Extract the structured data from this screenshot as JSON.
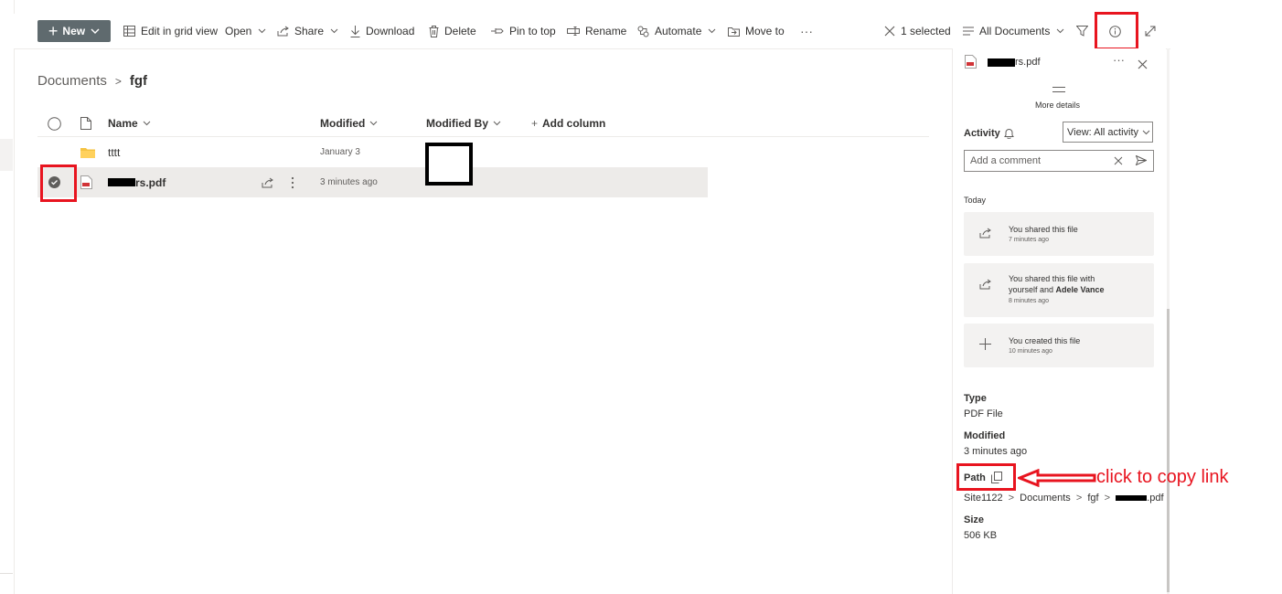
{
  "toolbar": {
    "new_label": "New",
    "edit_grid_label": "Edit in grid view",
    "open_label": "Open",
    "share_label": "Share",
    "download_label": "Download",
    "delete_label": "Delete",
    "pin_label": "Pin to top",
    "rename_label": "Rename",
    "automate_label": "Automate",
    "move_label": "Move to",
    "more_label": "···",
    "selected_label": "1 selected",
    "view_label": "All Documents"
  },
  "breadcrumb": {
    "root": "Documents",
    "current": "fgf"
  },
  "columns": {
    "name": "Name",
    "modified": "Modified",
    "modified_by": "Modified By",
    "add": "Add column"
  },
  "rows": [
    {
      "name": "tttt",
      "modified": "January 3",
      "type": "folder"
    },
    {
      "name_suffix": "rs.pdf",
      "modified": "3 minutes ago",
      "type": "pdf"
    }
  ],
  "details": {
    "file_name_suffix": "rs.pdf",
    "more_dots": "···",
    "more_details": "More details",
    "activity_label": "Activity",
    "view_filter": "View: All activity",
    "comment_placeholder": "Add a comment",
    "today_label": "Today",
    "activities": [
      {
        "line1": "You shared this file",
        "line2": "",
        "time": "7 minutes ago"
      },
      {
        "line1": "You shared this file with",
        "line2a": "yourself and ",
        "line2b": "Adele Vance",
        "time": "8 minutes ago"
      },
      {
        "line1": "You created this file",
        "line2": "",
        "time": "10 minutes ago"
      }
    ],
    "type_label": "Type",
    "type_value": "PDF File",
    "modified_label": "Modified",
    "modified_value": "3 minutes ago",
    "path_label": "Path",
    "path": {
      "site": "Site1122",
      "lib": "Documents",
      "folder": "fgf",
      "file_suffix": ".pdf"
    },
    "size_label": "Size",
    "size_value": "506 KB"
  },
  "annotation": {
    "text": "click to copy link"
  },
  "colors": {
    "accent": "#5f6a6e",
    "annotation_red": "#e8141f",
    "selected_row": "#edebe9",
    "card_bg": "#f3f2f1"
  }
}
